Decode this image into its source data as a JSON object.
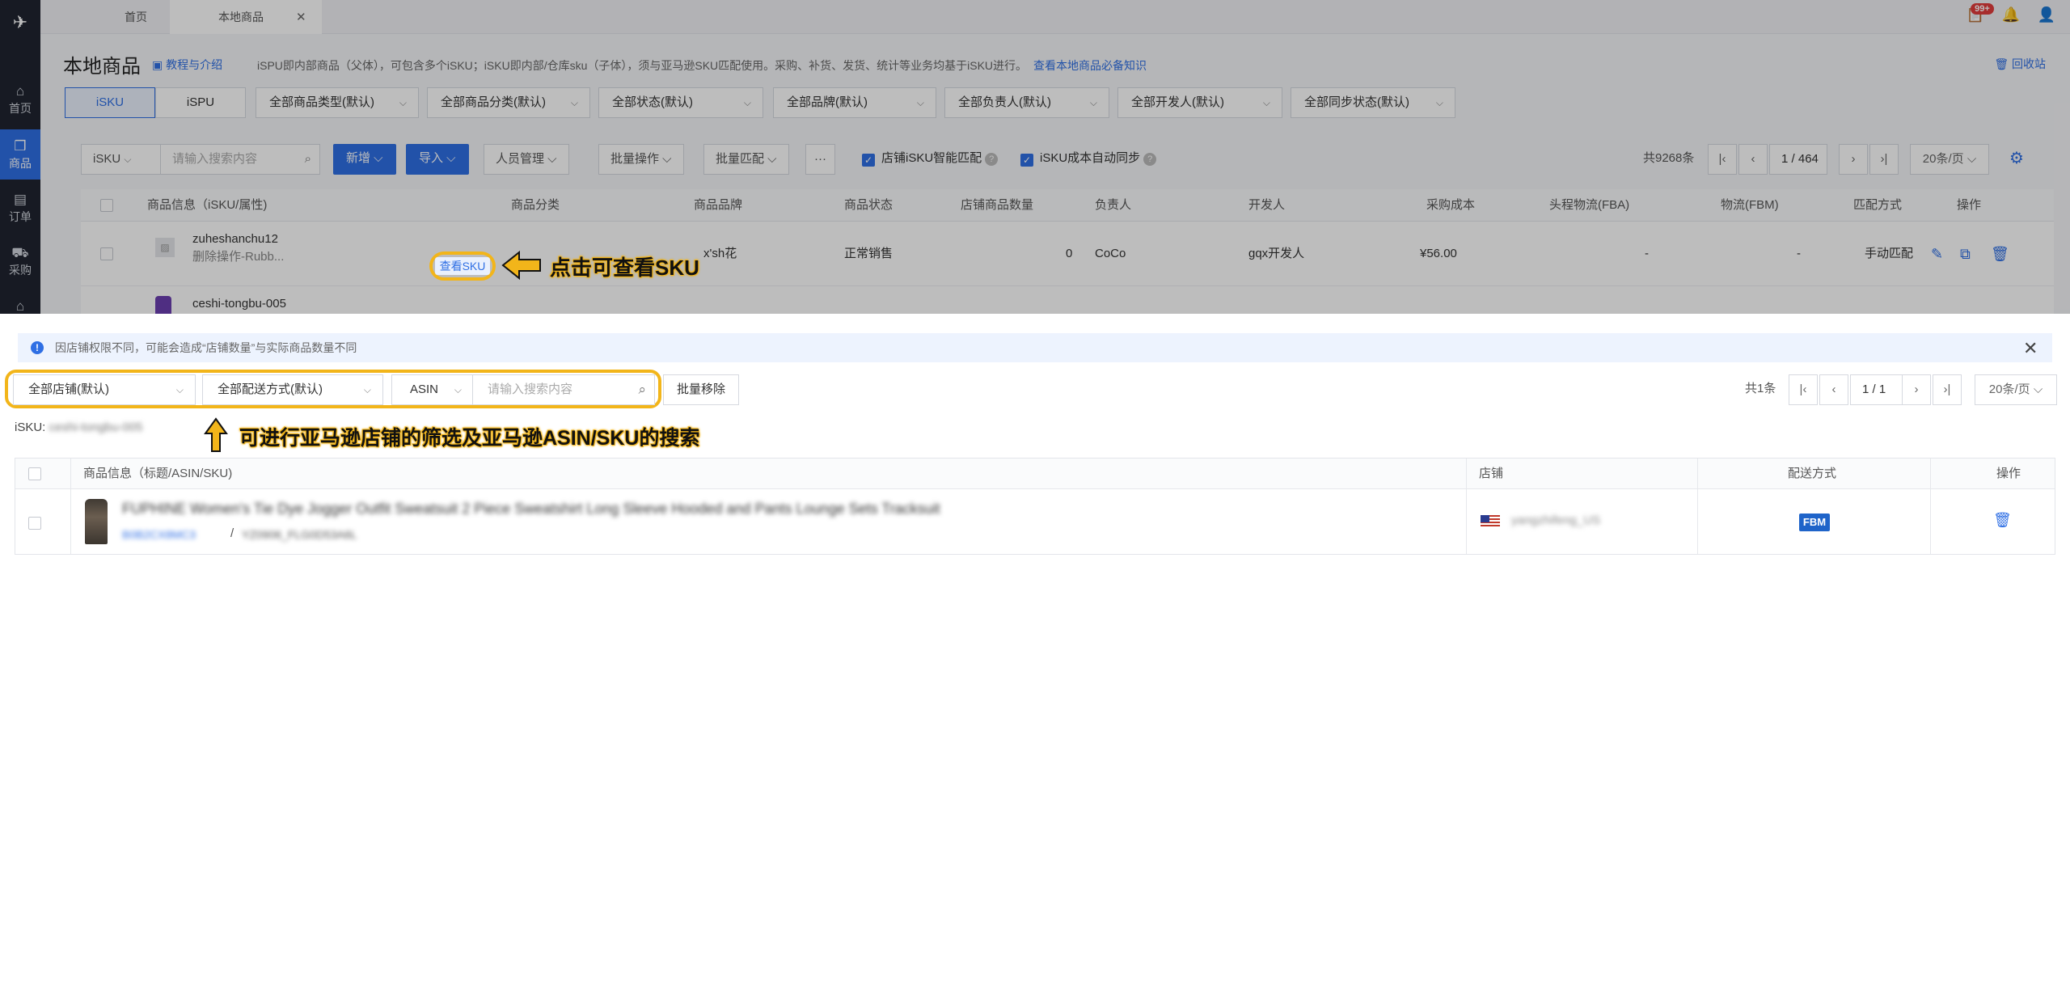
{
  "sidebar": {
    "items": [
      {
        "label": "首页",
        "icon": "home-icon"
      },
      {
        "label": "商品",
        "icon": "box-icon"
      },
      {
        "label": "订单",
        "icon": "order-icon"
      },
      {
        "label": "采购",
        "icon": "cart-icon"
      }
    ]
  },
  "tabs": [
    {
      "label": "首页"
    },
    {
      "label": "本地商品"
    }
  ],
  "header": {
    "badge": "99+",
    "title": "本地商品",
    "tutorial": "教程与介绍",
    "description": "iSPU即内部商品（父体），可包含多个iSKU；iSKU即内部/仓库sku（子体），须与亚马逊SKU匹配使用。采购、补货、发货、统计等业务均基于iSKU进行。",
    "knowledge_link": "查看本地商品必备知识",
    "recycle": "回收站"
  },
  "view_toggle": [
    "iSKU",
    "iSPU"
  ],
  "filters": [
    "全部商品类型(默认)",
    "全部商品分类(默认)",
    "全部状态(默认)",
    "全部品牌(默认)",
    "全部负责人(默认)",
    "全部开发人(默认)",
    "全部同步状态(默认)"
  ],
  "toolbar": {
    "search_type": "iSKU",
    "search_placeholder": "请输入搜索内容",
    "add": "新增",
    "import": "导入",
    "staff": "人员管理",
    "batch_ops": "批量操作",
    "batch_match": "批量匹配",
    "more": "···",
    "smart_match": "店铺iSKU智能匹配",
    "cost_sync": "iSKU成本自动同步"
  },
  "pager": {
    "total": "共9268条",
    "page": "1",
    "pages": "/ 464",
    "size": "20条/页"
  },
  "table": {
    "headers": [
      "商品信息（iSKU/属性)",
      "商品分类",
      "商品品牌",
      "商品状态",
      "店铺商品数量",
      "负责人",
      "开发人",
      "采购成本",
      "头程物流(FBA)",
      "物流(FBM)",
      "匹配方式",
      "操作"
    ],
    "rows": [
      {
        "name": "zuheshanchu12",
        "sub": "删除操作-Rubb...",
        "brand": "x'sh花",
        "status": "正常销售",
        "qty": "0",
        "owner": "CoCo",
        "dev": "gqx开发人",
        "cost": "¥56.00",
        "fba": "-",
        "fbm": "-",
        "match": "手动匹配",
        "view_sku": "查看SKU"
      },
      {
        "name": "ceshi-tongbu-005"
      }
    ]
  },
  "annotation_top": "点击可查看SKU",
  "dialog": {
    "notice": "因店铺权限不同，可能会造成“店铺数量”与实际商品数量不同",
    "store_filter": "全部店铺(默认)",
    "delivery_filter": "全部配送方式(默认)",
    "search_type": "ASIN",
    "search_placeholder": "请输入搜索内容",
    "batch_remove": "批量移除",
    "total": "共1条",
    "page": "1",
    "pages": "/ 1",
    "size": "20条/页",
    "isku_label": "iSKU:",
    "isku_value": "ceshi-tongbu-005",
    "annotation": "可进行亚马逊店铺的筛选及亚马逊ASIN/SKU的搜索",
    "headers": [
      "商品信息（标题/ASIN/SKU)",
      "店铺",
      "配送方式",
      "操作"
    ],
    "row": {
      "title": "FUPHINE Women's Tie Dye Jogger Outfit Sweatsuit 2 Piece Sweatshirt Long Sleeve Hooded and Pants Lounge Sets Tracksuit",
      "asin": "B0B2CX8MC3",
      "sku": "YZ0906_FLG0D53A6L",
      "store": "yangzhifeng_US",
      "delivery": "FBM"
    }
  }
}
